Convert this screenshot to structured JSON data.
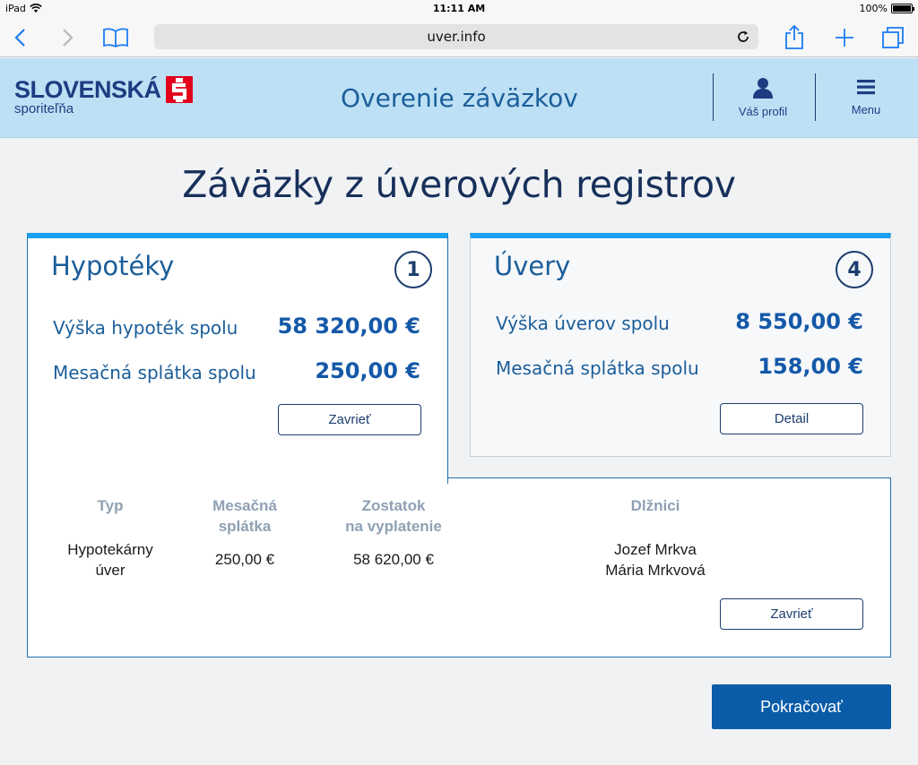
{
  "status_bar": {
    "device": "iPad",
    "time": "11:11 AM",
    "battery": "100%"
  },
  "browser": {
    "url": "uver.info"
  },
  "header": {
    "logo_main": "SLOVENSKÁ",
    "logo_sub": "sporiteľňa",
    "title": "Overenie záväzkov",
    "profile_label": "Váš profil",
    "menu_label": "Menu"
  },
  "page": {
    "title": "Záväzky z úverových registrov"
  },
  "hypoteky": {
    "title": "Hypotéky",
    "count": "1",
    "total_label": "Výška hypoték spolu",
    "total_value": "58 320,00 €",
    "monthly_label": "Mesačná splátka spolu",
    "monthly_value": "250,00 €",
    "button": "Zavrieť"
  },
  "uvery": {
    "title": "Úvery",
    "count": "4",
    "total_label": "Výška úverov spolu",
    "total_value": "8 550,00 €",
    "monthly_label": "Mesačná splátka spolu",
    "monthly_value": "158,00 €",
    "button": "Detail"
  },
  "detail": {
    "headers": {
      "type": [
        "Typ"
      ],
      "monthly": [
        "Mesačná",
        "splátka"
      ],
      "remaining": [
        "Zostatok",
        "na vyplatenie"
      ],
      "debtors": [
        "Dlžnici"
      ]
    },
    "row": {
      "type": [
        "Hypotekárny",
        "úver"
      ],
      "monthly": "250,00 €",
      "remaining": "58 620,00 €",
      "debtors": [
        "Jozef Mrkva",
        "Mária Mrkvová"
      ]
    },
    "button": "Zavrieť"
  },
  "continue_button": "Pokračovať",
  "colors": {
    "brand_navy": "#1d3d82",
    "accent_blue": "#1aa0f0",
    "header_bg": "#bde0f5",
    "primary": "#0a5ca8",
    "logo_red": "#e2001a"
  }
}
